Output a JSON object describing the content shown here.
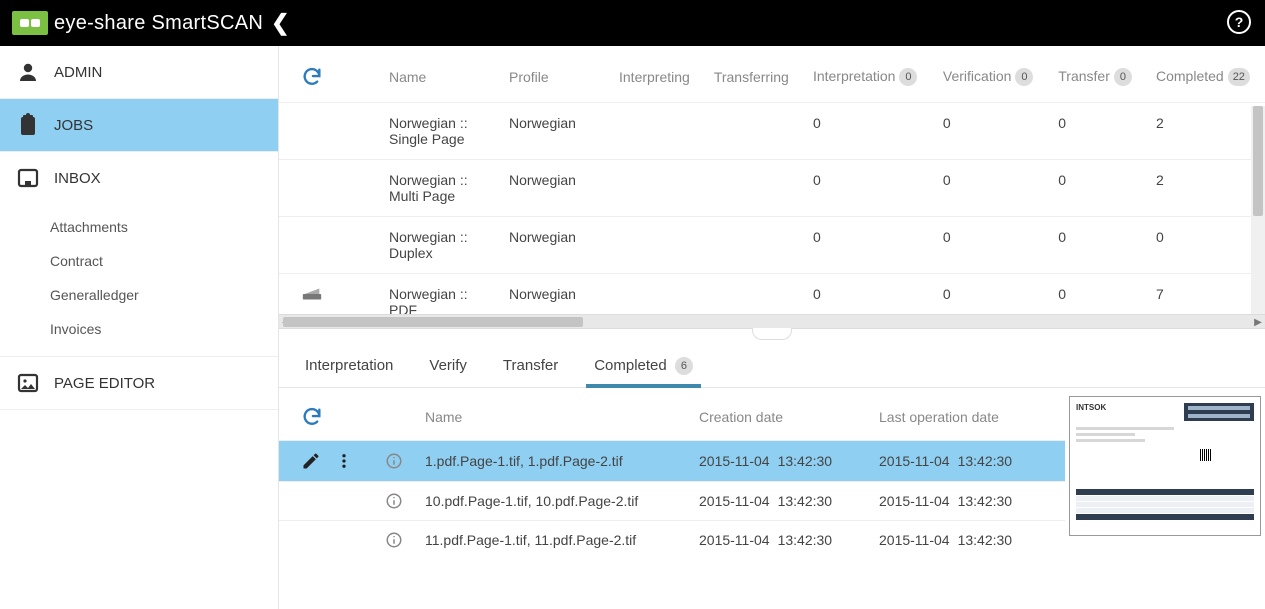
{
  "brand": {
    "name1": "eye-share ",
    "name2": "SmartSCAN"
  },
  "sidebar": {
    "admin": "ADMIN",
    "jobs": "JOBS",
    "inbox": "INBOX",
    "subs": [
      "Attachments",
      "Contract",
      "Generalledger",
      "Invoices"
    ],
    "page_editor": "PAGE EDITOR"
  },
  "jobs": {
    "headers": {
      "name": "Name",
      "profile": "Profile",
      "interpreting": "Interpreting",
      "transferring": "Transferring",
      "interpretation": "Interpretation",
      "interpretation_badge": "0",
      "verification": "Verification",
      "verification_badge": "0",
      "transfer": "Transfer",
      "transfer_badge": "0",
      "completed": "Completed",
      "completed_badge": "22"
    },
    "rows": [
      {
        "name": "Norwegian :: Single Page",
        "profile": "Norwegian",
        "interpreting": "",
        "transferring": "",
        "interpretation": "0",
        "verification": "0",
        "transfer": "0",
        "completed": "2",
        "icon": ""
      },
      {
        "name": "Norwegian :: Multi Page",
        "profile": "Norwegian",
        "interpreting": "",
        "transferring": "",
        "interpretation": "0",
        "verification": "0",
        "transfer": "0",
        "completed": "2",
        "icon": ""
      },
      {
        "name": "Norwegian :: Duplex",
        "profile": "Norwegian",
        "interpreting": "",
        "transferring": "",
        "interpretation": "0",
        "verification": "0",
        "transfer": "0",
        "completed": "0",
        "icon": ""
      },
      {
        "name": "Norwegian :: PDF",
        "profile": "Norwegian",
        "interpreting": "",
        "transferring": "",
        "interpretation": "0",
        "verification": "0",
        "transfer": "0",
        "completed": "7",
        "icon": "scanner"
      }
    ]
  },
  "detail": {
    "tabs": {
      "interpretation": "Interpretation",
      "verify": "Verify",
      "transfer": "Transfer",
      "completed": "Completed",
      "completed_badge": "6"
    },
    "headers": {
      "name": "Name",
      "creation": "Creation date",
      "lastop": "Last operation date"
    },
    "rows": [
      {
        "name": "1.pdf.Page-1.tif, 1.pdf.Page-2.tif",
        "cdate": "2015-11-04",
        "ctime": "13:42:30",
        "ldate": "2015-11-04",
        "ltime": "13:42:30",
        "selected": true
      },
      {
        "name": "10.pdf.Page-1.tif, 10.pdf.Page-2.tif",
        "cdate": "2015-11-04",
        "ctime": "13:42:30",
        "ldate": "2015-11-04",
        "ltime": "13:42:30",
        "selected": false
      },
      {
        "name": "11.pdf.Page-1.tif, 11.pdf.Page-2.tif",
        "cdate": "2015-11-04",
        "ctime": "13:42:30",
        "ldate": "2015-11-04",
        "ltime": "13:42:30",
        "selected": false
      }
    ],
    "preview_title": "INTSOK"
  }
}
